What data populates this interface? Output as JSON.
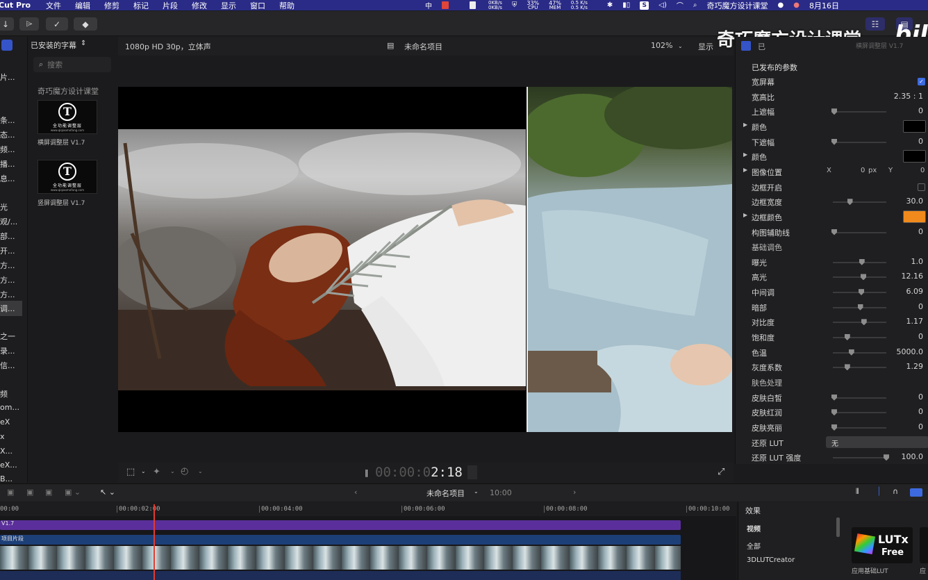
{
  "menubar": {
    "app_name": "Cut Pro",
    "menus": [
      "文件",
      "编辑",
      "修剪",
      "标记",
      "片段",
      "修改",
      "显示",
      "窗口",
      "帮助"
    ],
    "input_method": "中",
    "net_up": "0KB/s",
    "net_down": "0KB/s",
    "cpu_pct": "33%",
    "cpu_label": "CPU",
    "mem_pct": "47%",
    "mem_label": "MEM",
    "net2_up": "0.5 K/s",
    "net2_down": "0.5 K/s",
    "active_title": "奇巧魔方设计课堂",
    "date": "8月16日"
  },
  "sidebar": {
    "header": "已安装的字幕",
    "search_placeholder": "搜索",
    "group_label": "奇巧魔方设计课堂",
    "items": [
      {
        "label": "横屏调整层 V1.7",
        "logo_caption": "全功能调整层",
        "logo_sub": "www.qiqiaomofang.com"
      },
      {
        "label": "竖屏调整层 V1.7",
        "logo_caption": "全功能调整层",
        "logo_sub": "www.qiqiaomofang.com"
      }
    ],
    "left_fragments": [
      "片...",
      "条...",
      "态...",
      "频...",
      "播...",
      "息...",
      "光",
      "观/...",
      "部...",
      "开...",
      "方...",
      "方...",
      "方...",
      "调...",
      "之一",
      "录...",
      "信...",
      "频",
      "om...",
      "eX",
      "x",
      "X...",
      "eX...",
      "B..."
    ]
  },
  "viewer": {
    "format": "1080p HD 30p，立体声",
    "project_name": "未命名项目",
    "zoom": "102%",
    "display_menu": "显示",
    "timecode_dim": "00:00:0",
    "timecode_lit": "2:18"
  },
  "inspector": {
    "section_title": "已发布的参数",
    "header_fragment_1": "已",
    "header_fragment_2": "横屏调整层 V1.7",
    "rows": [
      {
        "label": "宽屏幕",
        "kind": "checkbox",
        "checked": true
      },
      {
        "label": "宽高比",
        "kind": "value",
        "value": "2.35 : 1"
      },
      {
        "label": "上遮幅",
        "kind": "slider",
        "value": "0",
        "level": 0.0
      },
      {
        "label": "颜色",
        "kind": "color",
        "disclosure": true,
        "color": "#000000"
      },
      {
        "label": "下遮幅",
        "kind": "slider",
        "value": "0",
        "level": 0.0
      },
      {
        "label": "颜色",
        "kind": "color",
        "disclosure": true,
        "color": "#000000"
      },
      {
        "label": "图像位置",
        "kind": "xy",
        "disclosure": true,
        "x_label": "X",
        "x_value": "0",
        "x_unit": "px",
        "y_label": "Y",
        "y_value": "0"
      },
      {
        "label": "边框开启",
        "kind": "checkbox",
        "checked": false
      },
      {
        "label": "边框宽度",
        "kind": "slider",
        "value": "30.0",
        "level": 0.3
      },
      {
        "label": "边框颜色",
        "kind": "color",
        "disclosure": true,
        "color": "#f08a1c"
      },
      {
        "label": "构图辅助线",
        "kind": "slider",
        "value": "0",
        "level": 0.0
      },
      {
        "label": "基础调色",
        "kind": "heading"
      },
      {
        "label": "曝光",
        "kind": "slider",
        "value": "1.0",
        "level": 0.53
      },
      {
        "label": "高光",
        "kind": "slider",
        "value": "12.16",
        "level": 0.56
      },
      {
        "label": "中间调",
        "kind": "slider",
        "value": "6.09",
        "level": 0.52
      },
      {
        "label": "暗部",
        "kind": "slider",
        "value": "0",
        "level": 0.5
      },
      {
        "label": "对比度",
        "kind": "slider",
        "value": "1.17",
        "level": 0.57
      },
      {
        "label": "饱和度",
        "kind": "slider",
        "value": "0",
        "level": 0.25
      },
      {
        "label": "色温",
        "kind": "slider",
        "value": "5000.0",
        "level": 0.33
      },
      {
        "label": "灰度系数",
        "kind": "slider",
        "value": "1.29",
        "level": 0.25
      },
      {
        "label": "肤色处理",
        "kind": "heading"
      },
      {
        "label": "皮肤白皙",
        "kind": "slider",
        "value": "0",
        "level": 0.0
      },
      {
        "label": "皮肤红润",
        "kind": "slider",
        "value": "0",
        "level": 0.0
      },
      {
        "label": "皮肤亮丽",
        "kind": "slider",
        "value": "0",
        "level": 0.0
      },
      {
        "label": "还原 LUT",
        "kind": "dropdown",
        "value": "无"
      },
      {
        "label": "还原 LUT 强度",
        "kind": "slider",
        "value": "100.0",
        "level": 1.0
      }
    ]
  },
  "watermark": {
    "text": "奇巧魔方设计课堂",
    "logo": "bili"
  },
  "timeline": {
    "project_name": "未命名项目",
    "duration": "10:00",
    "ruler": [
      "00:00",
      "00:00:02:00",
      "00:00:04:00",
      "00:00:06:00",
      "00:00:08:00",
      "00:00:10:00"
    ],
    "title_clip": "V1.7",
    "clip_label": "项目片段"
  },
  "effects": {
    "title": "效果",
    "categories": [
      "视频",
      "全部",
      "3DLUTCreator"
    ],
    "tile_name": "LUTx",
    "tile_sub": "Free",
    "tile_caption": "应用基础LUT",
    "tile2_caption": "应"
  },
  "colors": {
    "menubar": "#2a2b86",
    "accent_blue": "#3d6ae0",
    "playhead": "#e23b2f",
    "title_clip": "#5b2f9b",
    "clip_blue": "#1d3f78"
  }
}
